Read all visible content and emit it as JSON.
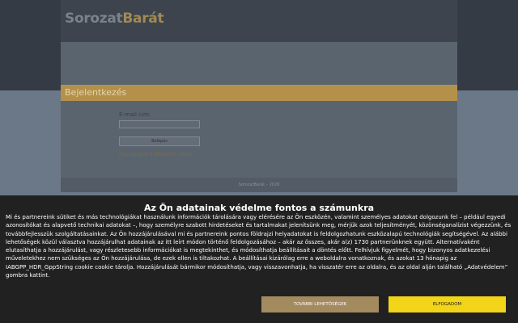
{
  "site": {
    "logo_part1": "Sorozat",
    "logo_part2": "Barát",
    "section_title": "Bejelentkezés",
    "footer_text": "SorozatBarát – 2026"
  },
  "login": {
    "email_label": "E-mail cím:",
    "email_value": "",
    "submit_label": "Belépés",
    "register_link": "Regisztráció",
    "separator": "|",
    "forgot_link": "Elfelejtett jelszó"
  },
  "consent": {
    "title": "Az Ön adatainak védelme fontos a számunkra",
    "body": "Mi és partnereink sütiket és más technológiákat használunk információk tárolására vagy elérésére az Ön eszközén, valamint személyes adatokat dolgozunk fel – például egyedi azonosítókat és alapvető technikai adatokat –, hogy személyre szabott hirdetéseket és tartalmakat jelenítsünk meg, mérjük azok teljesítményét, közönséganalízist végezzünk, és továbbfejlesszük szolgáltatásainkat. Az Ön hozzájárulásával mi és partnereink pontos földrajzi helyadatokat is feldolgozhatunk eszközalapú technológiák segítségével. Az alábbi lehetőségek közül választva hozzájárulhat adatainak az itt leírt módon történő feldolgozásához – akár az összes, akár a(z) 1730 partnerünknek együtt. Alternatívaként elutasíthatja a hozzájárulást, vagy részletesebb információkat is megtekinthet, és módosíthatja beállításait a döntés előtt. Felhívjuk figyelmét, hogy bizonyos adatkezelési műveletekhez nem szükséges az Ön hozzájárulása, de ezek ellen is tiltakozhat. A beállításai kizárólag erre a weboldalra vonatkoznak, és azokat 13 hónapig az IABGPP_HDR_GppString cookie cookie tárolja. Hozzájárulását bármikor módosíthatja, vagy visszavonhatja, ha visszatér erre az oldalra, és az oldal alján található „Adatvédelem” gombra kattint.",
    "more_options_label": "TOVÁBBI LEHETŐSÉGEK",
    "accept_label": "ELFOGADOM"
  },
  "colors": {
    "accent_gold": "#b4914b",
    "accept_yellow": "#f2d419",
    "consent_bg": "#212121"
  }
}
